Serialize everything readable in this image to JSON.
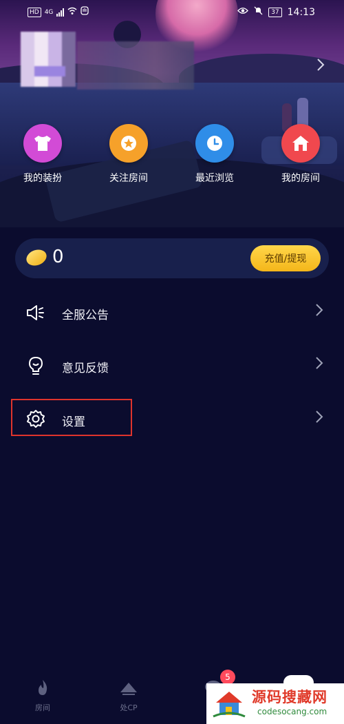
{
  "status_bar": {
    "hd": "HD",
    "network": "4G",
    "battery": "37",
    "time": "14:13"
  },
  "profile": {
    "username": "",
    "chevron_icon": "chevron-right-icon"
  },
  "quick_actions": [
    {
      "label": "我的装扮",
      "icon": "tshirt-icon",
      "color": "#d24bd6"
    },
    {
      "label": "关注房间",
      "icon": "star-icon",
      "color": "#f6a12a"
    },
    {
      "label": "最近浏览",
      "icon": "clock-icon",
      "color": "#2f8de8"
    },
    {
      "label": "我的房间",
      "icon": "home-icon",
      "color": "#f0484e"
    }
  ],
  "coins": {
    "value": "0",
    "recharge_label": "充值/提现"
  },
  "menu": [
    {
      "label": "全服公告",
      "icon": "megaphone-icon"
    },
    {
      "label": "意见反馈",
      "icon": "lightbulb-icon"
    },
    {
      "label": "设置",
      "icon": "gear-icon"
    }
  ],
  "bottom_nav": [
    {
      "label": "房间",
      "icon": "flame-icon"
    },
    {
      "label": "处CP",
      "icon": "mountain-icon"
    },
    {
      "label": "",
      "icon": "chat-icon"
    }
  ],
  "badge": "5",
  "watermark": {
    "title": "源码搜藏网",
    "url": "codesocang.com"
  }
}
